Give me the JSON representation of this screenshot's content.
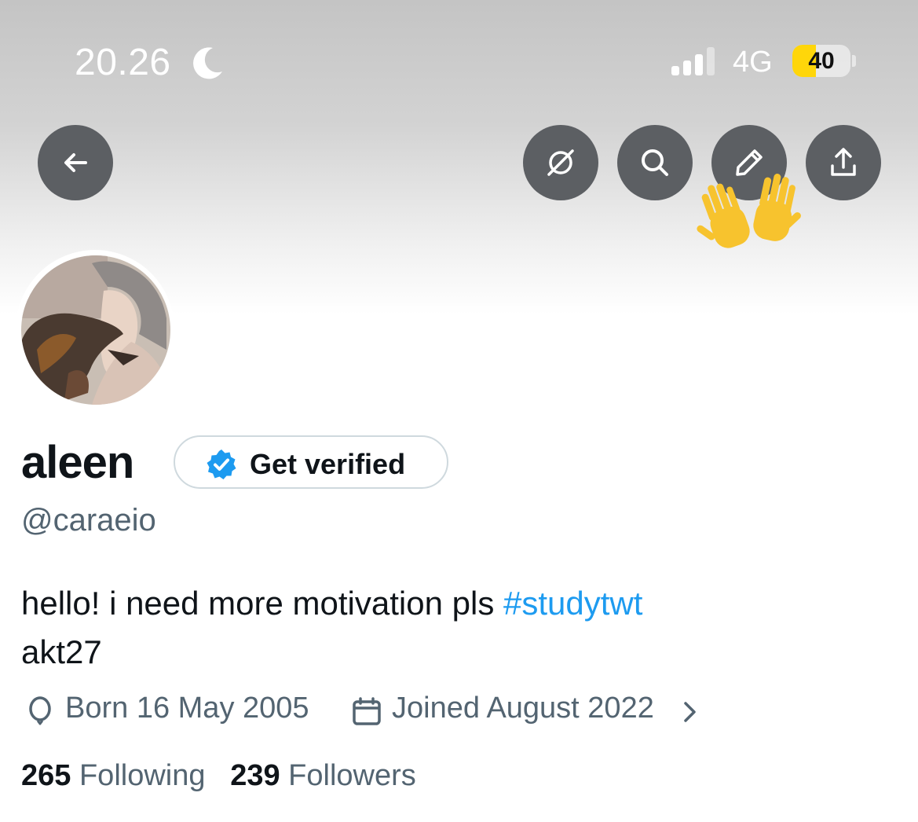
{
  "status_bar": {
    "time": "20.26",
    "network": "4G",
    "battery_level": 40,
    "battery_text": "40",
    "battery_color": "#ffd60a",
    "icons": [
      "moon-icon",
      "signal-icon",
      "battery-icon"
    ]
  },
  "header": {
    "buttons": [
      "back-arrow-icon",
      "grok-icon",
      "search-icon",
      "pencil-icon",
      "share-icon"
    ],
    "button_color": "#5c5f63",
    "emoji": "raised-hands-emoji"
  },
  "profile": {
    "display_name": "aleen",
    "verify_label": "Get verified",
    "handle": "@caraeio",
    "bio_text": "hello! i need more motivation pls ",
    "bio_hashtag": "#studytwt",
    "bio_line2": "akt27",
    "born": "Born 16 May 2005",
    "joined": "Joined August 2022",
    "following_count": "265",
    "following_label": "Following",
    "followers_count": "239",
    "followers_label": "Followers",
    "accent_color": "#1d9bf0"
  }
}
